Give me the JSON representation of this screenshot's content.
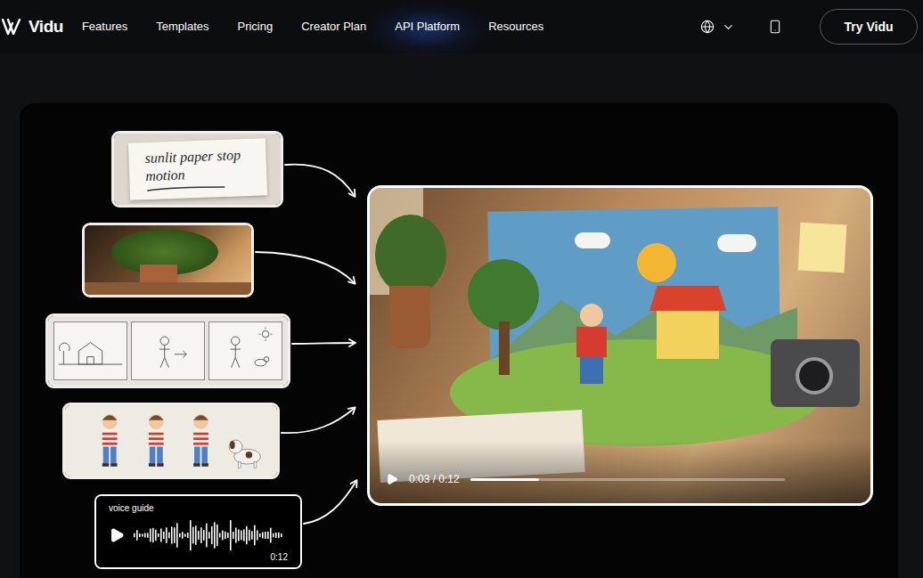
{
  "nav": {
    "logo": "Vidu",
    "items": [
      {
        "label": "Features",
        "selected": false
      },
      {
        "label": "Templates",
        "selected": false
      },
      {
        "label": "Pricing",
        "selected": false
      },
      {
        "label": "Creator Plan",
        "selected": false
      },
      {
        "label": "API Platform",
        "selected": true
      },
      {
        "label": "Resources",
        "selected": false
      }
    ],
    "language_menu": {
      "expanded": false
    },
    "cta": "Try Vidu"
  },
  "showcase": {
    "inputs": [
      {
        "kind": "note",
        "text": "sunlit paper stop motion"
      },
      {
        "kind": "photo"
      },
      {
        "kind": "storyboard"
      },
      {
        "kind": "character-sheet"
      },
      {
        "kind": "voice",
        "label": "voice guide",
        "duration": "0:12",
        "playing": false
      }
    ],
    "player": {
      "time": "0:03 / 0:12",
      "level": 0.22,
      "playing": false
    }
  }
}
